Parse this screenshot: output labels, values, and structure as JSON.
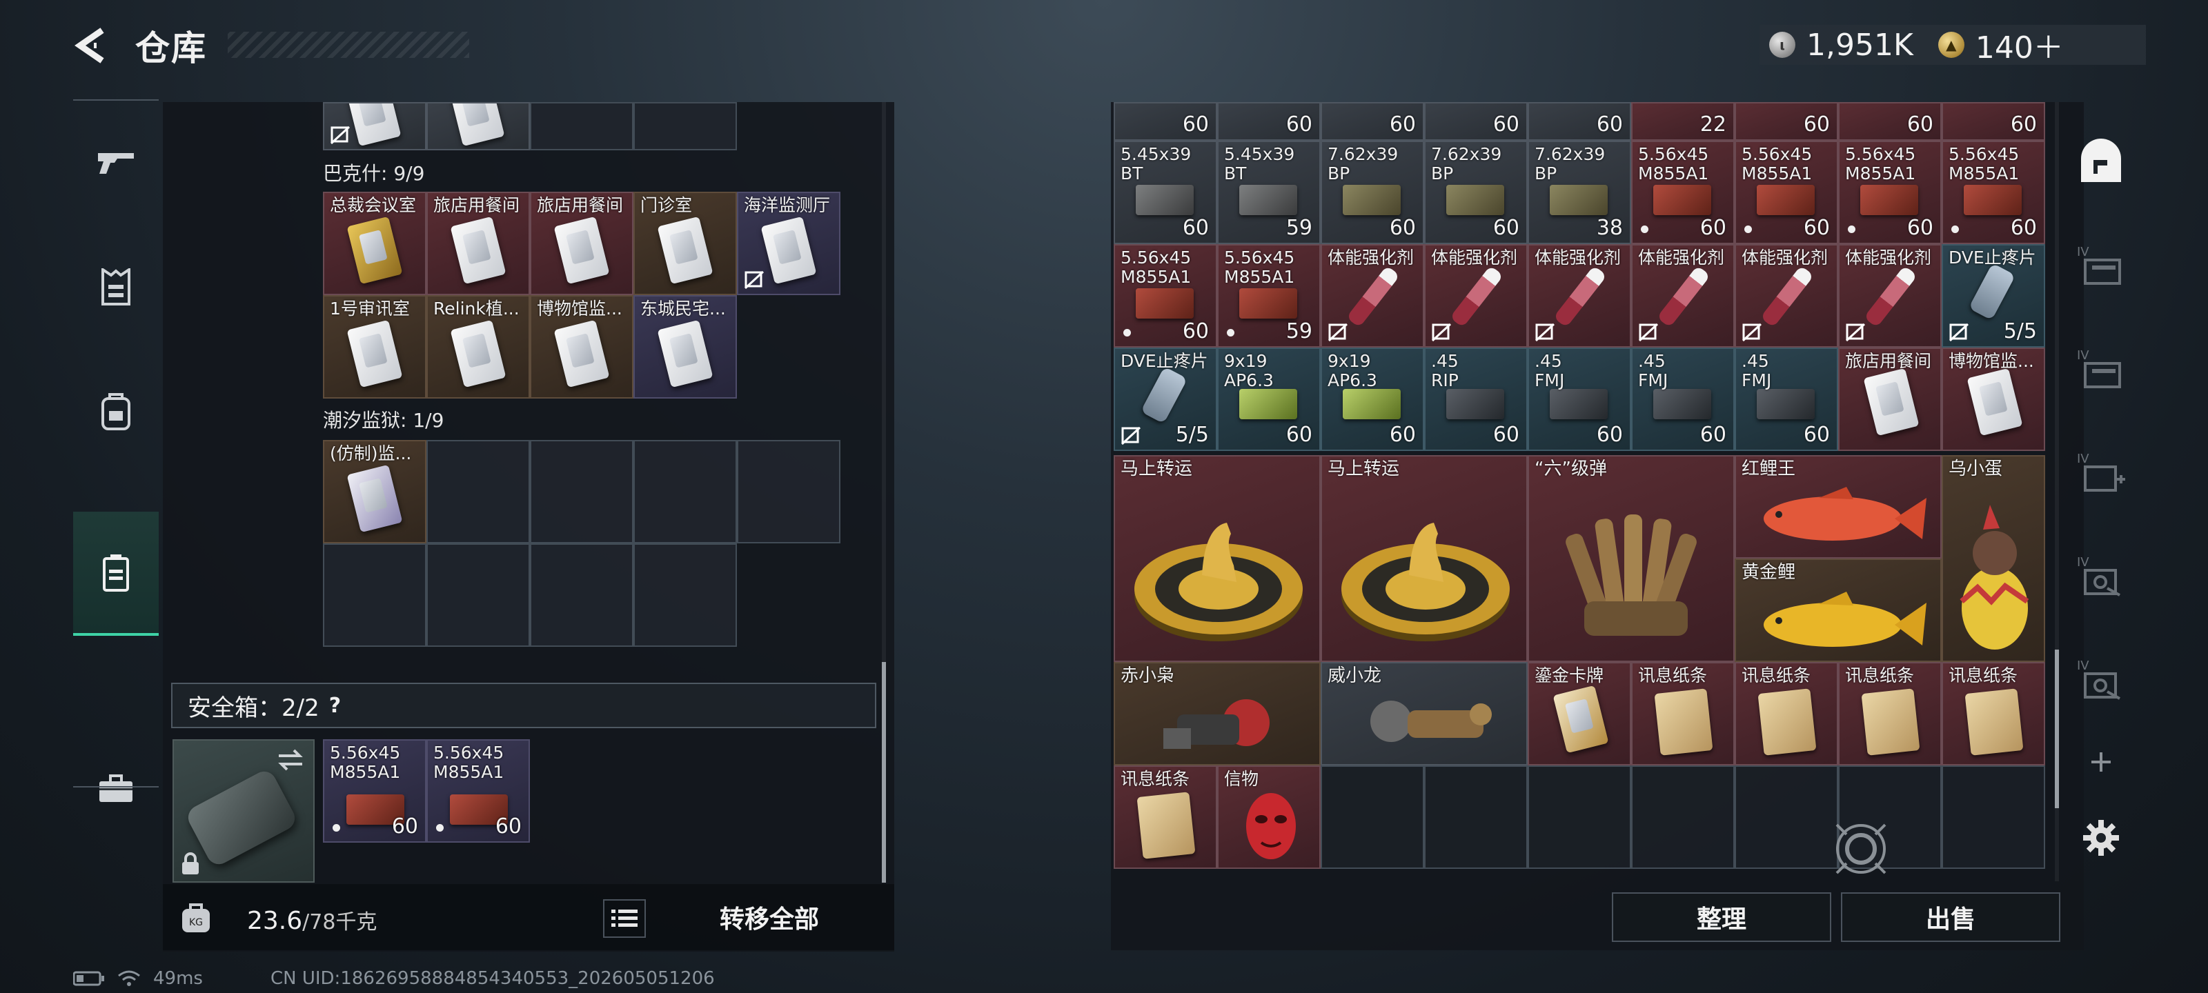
{
  "header": {
    "title": "仓库",
    "back_icon": "back-arrow-icon"
  },
  "currency": [
    {
      "icon": "silver-coin-icon",
      "value": "1,951K"
    },
    {
      "icon": "gold-coin-icon",
      "value": "140＋"
    }
  ],
  "left_nav": [
    "gun-icon",
    "armor-icon",
    "backpack-icon",
    "container-icon",
    "briefcase-icon"
  ],
  "sections": {
    "bks_title": "巴克什: 9/9",
    "chaoxi_title": "潮汐监狱: 1/9"
  },
  "top_partial_row": [
    {
      "label": "",
      "art": "card",
      "no_ship": true
    },
    {
      "label": "",
      "art": "card"
    }
  ],
  "bks_cards": [
    "总裁会议室",
    "旅店用餐间",
    "旅店用餐间",
    "门诊室",
    "海洋监测厅",
    "1号审讯室",
    "Relink植...",
    "博物馆监...",
    "东城民宅..."
  ],
  "chaoxi_cards": [
    "(仿制)监..."
  ],
  "safe_box": {
    "title": "安全箱：2/2",
    "help": "?",
    "items": [
      {
        "label": "5.56x45\nM855A1",
        "count": "60"
      },
      {
        "label": "5.56x45\nM855A1",
        "count": "60"
      }
    ]
  },
  "weight": {
    "current": "23.6",
    "max": "/78千克"
  },
  "transfer_all": "转移全部",
  "status": {
    "latency": "49ms",
    "uid": "CN UID:18626958884854340553_202605051206"
  },
  "stash": {
    "row0_counts": [
      "60",
      "60",
      "60",
      "60",
      "60",
      "22",
      "60",
      "60",
      "60"
    ],
    "row1": [
      {
        "label": "5.45x39\nBT",
        "count": "60",
        "art": "ammo-gray"
      },
      {
        "label": "5.45x39\nBT",
        "count": "59",
        "art": "ammo-gray"
      },
      {
        "label": "7.62x39\nBP",
        "count": "60",
        "art": "ammo-olive"
      },
      {
        "label": "7.62x39\nBP",
        "count": "60",
        "art": "ammo-olive"
      },
      {
        "label": "7.62x39\nBP",
        "count": "38",
        "art": "ammo-olive"
      },
      {
        "label": "5.56x45\nM855A1",
        "count": "60",
        "art": "ammo-red",
        "dot": true
      },
      {
        "label": "5.56x45\nM855A1",
        "count": "60",
        "art": "ammo-red",
        "dot": true
      },
      {
        "label": "5.56x45\nM855A1",
        "count": "60",
        "art": "ammo-red",
        "dot": true
      },
      {
        "label": "5.56x45\nM855A1",
        "count": "60",
        "art": "ammo-red",
        "dot": true
      }
    ],
    "row2": [
      {
        "label": "5.56x45\nM855A1",
        "count": "60",
        "art": "ammo-red",
        "dot": true
      },
      {
        "label": "5.56x45\nM855A1",
        "count": "59",
        "art": "ammo-red",
        "dot": true
      },
      {
        "label": "体能强化剂",
        "count": "",
        "art": "syringe",
        "no_ship": true
      },
      {
        "label": "体能强化剂",
        "count": "",
        "art": "syringe",
        "no_ship": true
      },
      {
        "label": "体能强化剂",
        "count": "",
        "art": "syringe",
        "no_ship": true
      },
      {
        "label": "体能强化剂",
        "count": "",
        "art": "syringe",
        "no_ship": true
      },
      {
        "label": "体能强化剂",
        "count": "",
        "art": "syringe",
        "no_ship": true
      },
      {
        "label": "体能强化剂",
        "count": "",
        "art": "syringe",
        "no_ship": true
      },
      {
        "label": "DVE止疼片",
        "count": "5/5",
        "art": "pill",
        "no_ship": true
      }
    ],
    "row3": [
      {
        "label": "DVE止疼片",
        "count": "5/5",
        "art": "pill",
        "no_ship": true
      },
      {
        "label": "9x19\nAP6.3",
        "count": "60",
        "art": "ammo-green"
      },
      {
        "label": "9x19\nAP6.3",
        "count": "60",
        "art": "ammo-green"
      },
      {
        "label": ".45\nRIP",
        "count": "60",
        "art": "ammo-dark"
      },
      {
        "label": ".45\nFMJ",
        "count": "60",
        "art": "ammo-dark"
      },
      {
        "label": ".45\nFMJ",
        "count": "60",
        "art": "ammo-dark"
      },
      {
        "label": ".45\nFMJ",
        "count": "60",
        "art": "ammo-dark"
      },
      {
        "label": "旅店用餐间",
        "count": "",
        "art": "card"
      },
      {
        "label": "博物馆监...",
        "count": "",
        "art": "card"
      }
    ],
    "big_items": [
      {
        "label": "马上转运",
        "art": "disc"
      },
      {
        "label": "马上转运",
        "art": "disc"
      },
      {
        "label": "“六”级弹",
        "art": "bullets"
      },
      {
        "label": "红鲤王",
        "art": "fish-red"
      },
      {
        "label": "黄金鲤",
        "art": "fish-gold"
      },
      {
        "label": "乌小蛋",
        "art": "egg"
      }
    ],
    "row6": [
      {
        "label": "赤小枭",
        "art": "figure"
      },
      {
        "label": "威小龙",
        "art": "figure"
      },
      {
        "label": "鎏金卡牌",
        "art": "goldcard"
      },
      {
        "label": "讯息纸条",
        "art": "paper"
      },
      {
        "label": "讯息纸条",
        "art": "paper"
      },
      {
        "label": "讯息纸条",
        "art": "paper"
      },
      {
        "label": "讯息纸条",
        "art": "paper"
      }
    ],
    "row7": [
      {
        "label": "讯息纸条",
        "art": "paper"
      },
      {
        "label": "信物",
        "art": "mask"
      }
    ]
  },
  "buttons": {
    "sort": "整理",
    "sell": "出售"
  },
  "right_nav": [
    "vault-icon",
    "iv-folder-icon",
    "iv-folder-icon",
    "iv-add-icon",
    "iv-vault-icon",
    "iv-vault-icon",
    "plus-icon",
    "settings-icon"
  ],
  "right_nav_badges": [
    "IV",
    "IV",
    "IV",
    "IV",
    "IV"
  ],
  "colors": {
    "accent": "#3ed3a6",
    "red_cell": "#5a2d33",
    "teal_cell": "#2c4450"
  }
}
